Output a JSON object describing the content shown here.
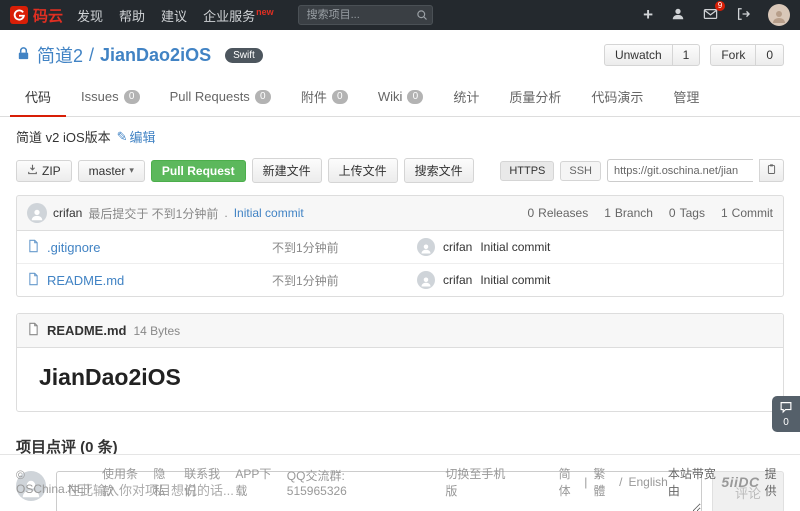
{
  "navbar": {
    "logo_text": "码云",
    "items": [
      {
        "label": "发现"
      },
      {
        "label": "帮助"
      },
      {
        "label": "建议"
      },
      {
        "label": "企业服务",
        "badge": "new"
      }
    ],
    "search_placeholder": "搜索项目...",
    "message_badge": "9"
  },
  "repo": {
    "owner": "简道2",
    "separator": "/",
    "name": "JianDao2iOS",
    "language": "Swift",
    "unwatch_label": "Unwatch",
    "unwatch_count": "1",
    "fork_label": "Fork",
    "fork_count": "0",
    "description": "简道 v2 iOS版本",
    "edit_label": "编辑"
  },
  "tabs": [
    {
      "label": "代码"
    },
    {
      "label": "Issues",
      "count": "0"
    },
    {
      "label": "Pull Requests",
      "count": "0"
    },
    {
      "label": "附件",
      "count": "0"
    },
    {
      "label": "Wiki",
      "count": "0"
    },
    {
      "label": "统计"
    },
    {
      "label": "质量分析"
    },
    {
      "label": "代码演示"
    },
    {
      "label": "管理"
    }
  ],
  "toolbar": {
    "zip": "ZIP",
    "branch": "master",
    "pull_request": "Pull Request",
    "new_file": "新建文件",
    "upload_file": "上传文件",
    "search_file": "搜索文件",
    "https": "HTTPS",
    "ssh": "SSH",
    "clone_url": "https://git.oschina.net/jian"
  },
  "commit_bar": {
    "author": "crifan",
    "prefix": "最后提交于 不到1分钟前",
    "dot": ".",
    "message": "Initial commit",
    "stats": [
      {
        "count": "0",
        "label": "Releases"
      },
      {
        "count": "1",
        "label": "Branch"
      },
      {
        "count": "0",
        "label": "Tags"
      },
      {
        "count": "1",
        "label": "Commit"
      }
    ]
  },
  "files": [
    {
      "name": ".gitignore",
      "time": "不到1分钟前",
      "author": "crifan",
      "message": "Initial commit"
    },
    {
      "name": "README.md",
      "time": "不到1分钟前",
      "author": "crifan",
      "message": "Initial commit"
    }
  ],
  "readme": {
    "filename": "README.md",
    "size": "14 Bytes",
    "heading": "JianDao2iOS"
  },
  "comments": {
    "heading": "项目点评 (0 条)",
    "placeholder": "在此输入你对项目想说的话...",
    "submit": "评论",
    "widget_count": "0"
  },
  "footer": {
    "copyright": "© OSChina.NET",
    "links": [
      {
        "label": "使用条款"
      },
      {
        "label": "隐私"
      },
      {
        "label": "联系我们"
      },
      {
        "label": "APP下载"
      }
    ],
    "qq_group": "QQ交流群: 515965326",
    "mobile": "切换至手机版",
    "languages": [
      {
        "label": "简 体"
      },
      {
        "label": "繁 體"
      },
      {
        "label": "English"
      }
    ],
    "lang_sep1": "|",
    "lang_sep2": "/",
    "bandwidth_prefix": "本站带宽由",
    "bandwidth_brand": "5iiDC",
    "bandwidth_suffix": "提供"
  }
}
